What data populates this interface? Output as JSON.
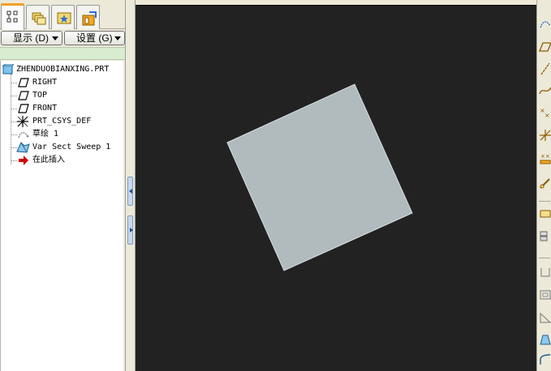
{
  "navigator": {
    "tabs": [
      {
        "name": "model-tree-tab",
        "icon": "model-tree-icon",
        "active": true
      },
      {
        "name": "folder-browser-tab",
        "icon": "folder-browser-icon",
        "active": false
      },
      {
        "name": "favorites-tab",
        "icon": "favorites-icon",
        "active": false
      },
      {
        "name": "connections-tab",
        "icon": "connections-icon",
        "active": false
      }
    ],
    "show_label": "显示 (D)",
    "settings_label": "设置 (G)",
    "tree": {
      "root": "ZHENDUOBIANXING.PRT",
      "items": [
        {
          "label": "RIGHT",
          "icon": "datum-plane-icon"
        },
        {
          "label": "TOP",
          "icon": "datum-plane-icon"
        },
        {
          "label": "FRONT",
          "icon": "datum-plane-icon"
        },
        {
          "label": "PRT_CSYS_DEF",
          "icon": "coordinate-system-icon"
        },
        {
          "label": "草绘 1",
          "icon": "sketch-icon"
        },
        {
          "label": "Var Sect Sweep 1",
          "icon": "sweep-feature-icon"
        },
        {
          "label": "在此插入",
          "icon": "insert-here-arrow-icon"
        }
      ]
    }
  },
  "viewport": {
    "background": "#222222",
    "surface_color": "#b1bbbe",
    "edge_color": "#d7dfe2"
  },
  "right_toolbar": {
    "buttons": [
      "datum-display-icon",
      "datum-plane-tool-icon",
      "datum-axis-tool-icon",
      "datum-curve-tool-icon",
      "datum-point-tool-icon",
      "csys-tool-icon",
      "analysis-feature-icon",
      "sketch-tool-icon",
      "extrude-tool-icon",
      "revolve-tool-icon",
      "hole-tool-icon",
      "shell-tool-icon",
      "rib-tool-icon",
      "draft-tool-icon",
      "round-tool-icon"
    ]
  },
  "colors": {
    "tab_accent": "#f1a026",
    "filter_bar": "#d8ecd0",
    "insert_arrow": "#d40000"
  }
}
